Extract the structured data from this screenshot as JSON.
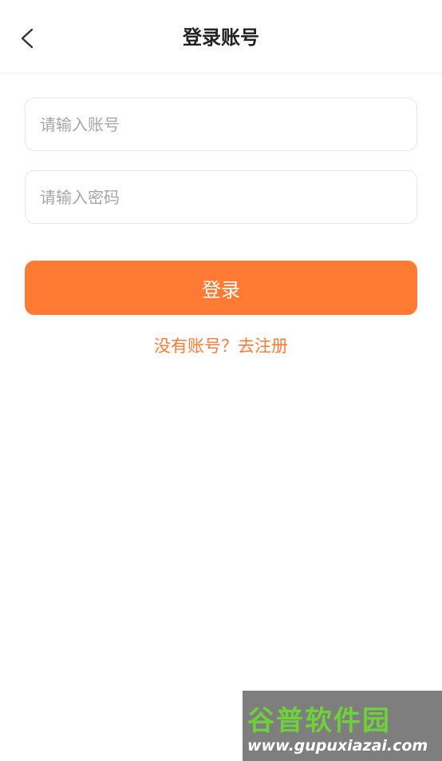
{
  "header": {
    "title": "登录账号",
    "back_icon": "chevron-left-icon"
  },
  "form": {
    "account_placeholder": "请输入账号",
    "account_value": "",
    "password_placeholder": "请输入密码",
    "password_value": "",
    "login_label": "登录",
    "register_link": "没有账号？去注册"
  },
  "colors": {
    "accent": "#ff7a33",
    "title_text": "#222222",
    "placeholder": "#a6a6a6",
    "border": "#e6e6e6"
  },
  "watermark": {
    "name": "谷普软件园",
    "url": "www.gupuxiazai.com"
  }
}
